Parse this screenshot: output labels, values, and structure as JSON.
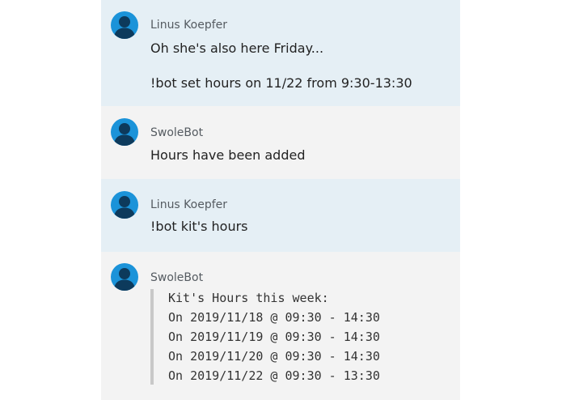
{
  "messages": [
    {
      "sender": "Linus Koepfer",
      "lines": [
        "Oh she's also here Friday...",
        "!bot set hours on 11/22 from 9:30-13:30"
      ]
    },
    {
      "sender": "SwoleBot",
      "lines": [
        "Hours have been added"
      ]
    },
    {
      "sender": "Linus Koepfer",
      "lines": [
        "!bot kit's hours"
      ]
    },
    {
      "sender": "SwoleBot",
      "quote_lines": [
        "Kit's Hours this week:",
        "On 2019/11/18 @ 09:30 - 14:30",
        "On 2019/11/19 @ 09:30 - 14:30",
        "On 2019/11/20 @ 09:30 - 14:30",
        "On 2019/11/22 @ 09:30 - 13:30"
      ]
    }
  ],
  "colors": {
    "user_bg": "#e5eff5",
    "bot_bg": "#f3f3f3",
    "avatar": "#1b93d9",
    "avatar_figure": "#0d3a5c"
  },
  "icons": {
    "avatar": "person-silhouette-icon"
  }
}
